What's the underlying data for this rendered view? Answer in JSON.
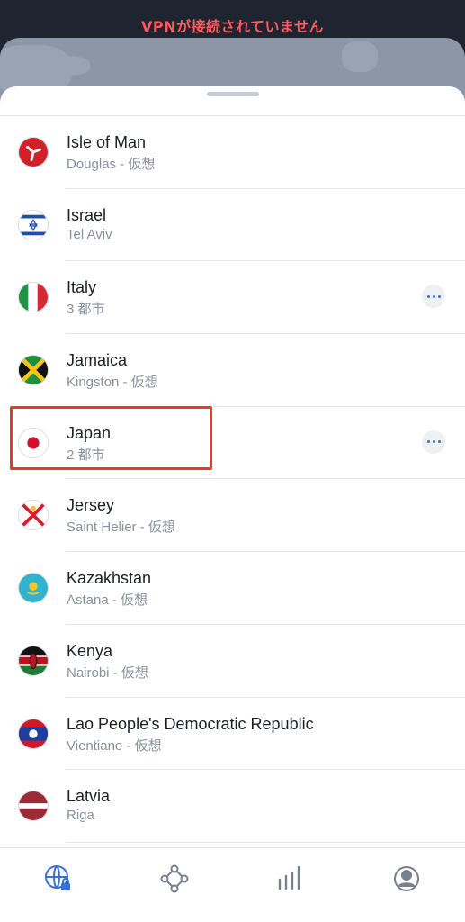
{
  "status": {
    "text": "VPNが接続されていません",
    "color": "#ff5a5f"
  },
  "map": {
    "bell_icon": "bell-icon"
  },
  "countries": [
    {
      "name": "Isle of Man",
      "sub": "Douglas - 仮想",
      "flag": "isle-of-man-flag-icon",
      "has_more": false
    },
    {
      "name": "Israel",
      "sub": "Tel Aviv",
      "flag": "israel-flag-icon",
      "has_more": false
    },
    {
      "name": "Italy",
      "sub": "3 都市",
      "flag": "italy-flag-icon",
      "has_more": true
    },
    {
      "name": "Jamaica",
      "sub": "Kingston - 仮想",
      "flag": "jamaica-flag-icon",
      "has_more": false
    },
    {
      "name": "Japan",
      "sub": "2 都市",
      "flag": "japan-flag-icon",
      "has_more": true
    },
    {
      "name": "Jersey",
      "sub": "Saint Helier - 仮想",
      "flag": "jersey-flag-icon",
      "has_more": false
    },
    {
      "name": "Kazakhstan",
      "sub": "Astana - 仮想",
      "flag": "kazakhstan-flag-icon",
      "has_more": false
    },
    {
      "name": "Kenya",
      "sub": "Nairobi - 仮想",
      "flag": "kenya-flag-icon",
      "has_more": false
    },
    {
      "name": "Lao People's Democratic Republic",
      "sub": "Vientiane - 仮想",
      "flag": "laos-flag-icon",
      "has_more": false
    },
    {
      "name": "Latvia",
      "sub": "Riga",
      "flag": "latvia-flag-icon",
      "has_more": false
    }
  ],
  "bottom_nav": [
    {
      "icon": "globe-lock-icon",
      "active": true
    },
    {
      "icon": "meshnet-icon",
      "active": false
    },
    {
      "icon": "stats-bars-icon",
      "active": false
    },
    {
      "icon": "profile-icon",
      "active": false
    }
  ],
  "colors": {
    "accent": "#3a6fd8",
    "highlight": "#e53c25"
  }
}
